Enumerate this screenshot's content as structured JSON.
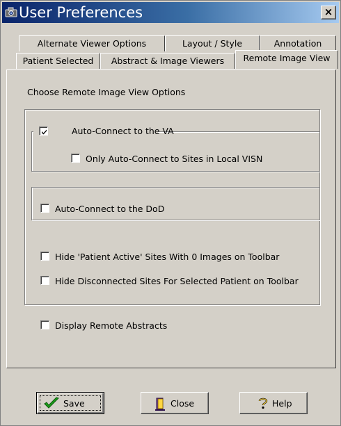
{
  "window": {
    "title": "User Preferences",
    "close_label": "×"
  },
  "tabs": {
    "row1": [
      {
        "label": "Alternate Viewer Options"
      },
      {
        "label": "Layout / Style"
      },
      {
        "label": "Annotation"
      }
    ],
    "row2": [
      {
        "label": "Patient Selected"
      },
      {
        "label": "Abstract & Image Viewers"
      },
      {
        "label": "Remote Image View",
        "active": true
      }
    ]
  },
  "panel": {
    "heading": "Choose Remote Image View Options",
    "options": {
      "auto_connect_va": {
        "label": "Auto-Connect to the VA",
        "checked": true
      },
      "only_local_visn": {
        "label": "Only Auto-Connect to Sites in Local VISN",
        "checked": false
      },
      "auto_connect_dod": {
        "label": "Auto-Connect to the DoD",
        "checked": false
      },
      "hide_patient_active": {
        "label": "Hide 'Patient Active' Sites With 0 Images on Toolbar",
        "checked": false
      },
      "hide_disconnected": {
        "label": "Hide Disconnected Sites For Selected Patient on Toolbar",
        "checked": false
      },
      "display_remote_abstracts": {
        "label": "Display Remote Abstracts",
        "checked": false
      }
    }
  },
  "buttons": {
    "save": "Save",
    "close": "Close",
    "help": "Help"
  },
  "icons": {
    "title": "camera-icon",
    "save": "checkmark-icon",
    "close": "door-icon",
    "help": "question-icon"
  }
}
